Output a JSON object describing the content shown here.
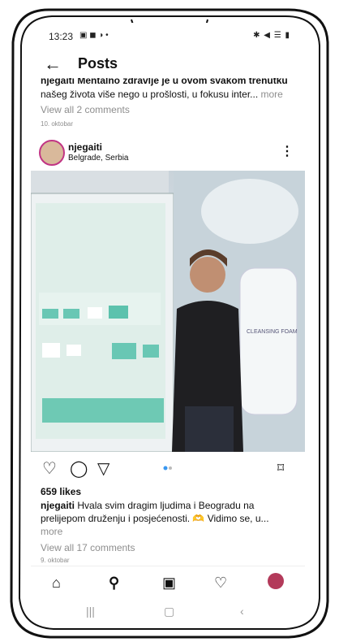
{
  "status_bar": {
    "time": "13:23",
    "icons_left": "▣ ◼ ◑ •",
    "icons_right": "✱ ◀ ☰ ▮"
  },
  "header": {
    "back_icon": "arrow-left-icon",
    "title": "Posts"
  },
  "previous_post": {
    "caption_cut": "njegaiti Mentalno zdravlje je u ovom svakom trenutku",
    "caption_line2": "našeg života više nego u prošlosti, u fokusu  inter...",
    "more": "more",
    "view_comments": "View all 2 comments",
    "date": "10. oktobar"
  },
  "post": {
    "username": "njegaiti",
    "location": "Belgrade, Serbia",
    "likes": "659 likes",
    "caption_user": "njegaiti",
    "caption_text": "Hvala svim dragim ljudima i Beogradu na prelijepom druženju i posjećenosti. 🫶 Vidimo se, u...",
    "more": "more",
    "view_comments": "View all 17 comments",
    "date": "9. oktobar",
    "product_label": "CLEANSING FOAM"
  },
  "colors": {
    "avatar_ring": "#c13584",
    "carousel_active": "#3897f0"
  }
}
